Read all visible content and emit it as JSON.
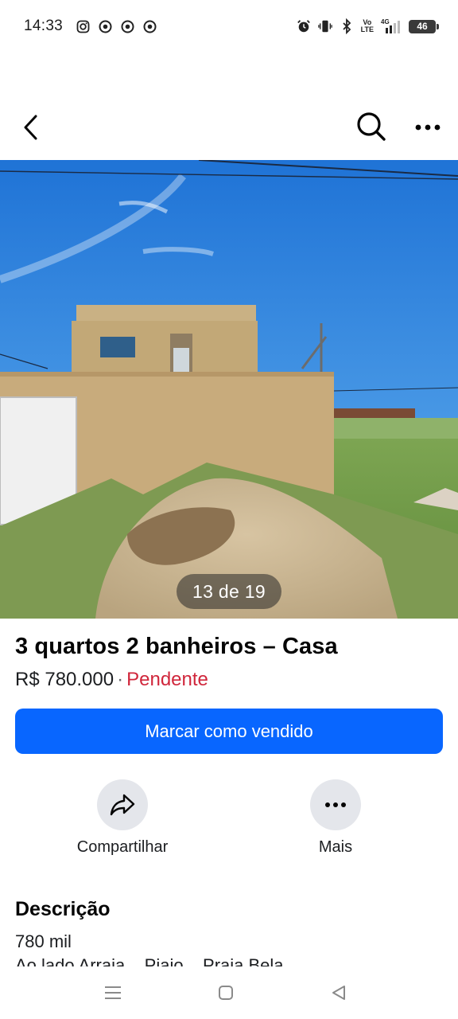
{
  "status_bar": {
    "time": "14:33",
    "notification_icons": [
      "instagram-icon",
      "chrome-icon",
      "chrome-icon",
      "chrome-icon"
    ],
    "system_icons": [
      "alarm-icon",
      "vibrate-icon",
      "bluetooth-icon",
      "volte-icon",
      "signal-4g-icon",
      "battery-icon"
    ],
    "volte_label": "Vo\nLTE",
    "network_label": "4G",
    "battery_level": "46"
  },
  "app_bar": {
    "back_icon": "chevron-left-icon",
    "search_icon": "search-icon",
    "more_icon": "more-horizontal-icon"
  },
  "photo": {
    "counter": "13 de 19"
  },
  "listing": {
    "title": "3 quartos 2 banheiros – Casa",
    "price": "R$ 780.000",
    "separator": "·",
    "status": "Pendente"
  },
  "primary_button": {
    "label": "Marcar como vendido"
  },
  "actions": [
    {
      "label": "Compartilhar",
      "icon": "share-icon"
    },
    {
      "label": "Mais",
      "icon": "more-horizontal-icon"
    }
  ],
  "description": {
    "heading": "Descrição",
    "line1": "780 mil",
    "line2": "Ao lado Arraia... Piajo... Praia Bela"
  },
  "colors": {
    "primary": "#0866ff",
    "status_pending": "#d0263b",
    "action_circle": "#e4e6eb"
  }
}
